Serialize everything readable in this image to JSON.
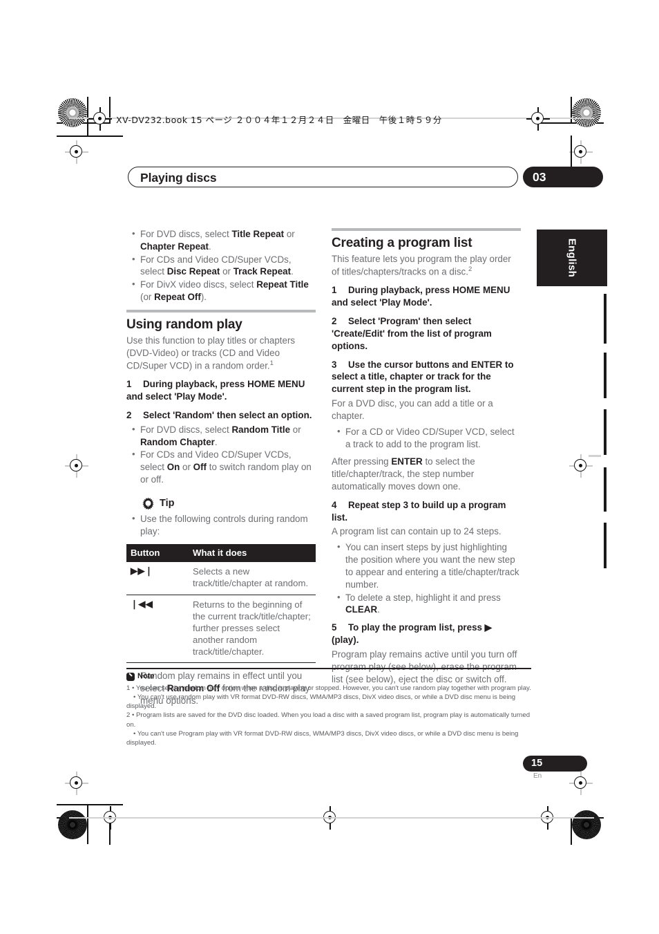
{
  "header": {
    "file_line": "XV-DV232.book  15 ページ  ２００４年１２月２４日　金曜日　午後１時５９分",
    "running_title": "Playing discs",
    "chapter_number": "03",
    "language_tab": "English"
  },
  "left_column": {
    "repeat_options": [
      {
        "parts": [
          {
            "t": "For DVD discs, select ",
            "b": false
          },
          {
            "t": "Title Repeat",
            "b": true
          },
          {
            "t": " or ",
            "b": false
          },
          {
            "t": "Chapter Repeat",
            "b": true
          },
          {
            "t": ".",
            "b": false
          }
        ]
      },
      {
        "parts": [
          {
            "t": "For CDs and Video CD/Super VCDs, select ",
            "b": false
          },
          {
            "t": "Disc Repeat",
            "b": true
          },
          {
            "t": " or ",
            "b": false
          },
          {
            "t": "Track Repeat",
            "b": true
          },
          {
            "t": ".",
            "b": false
          }
        ]
      },
      {
        "parts": [
          {
            "t": "For DivX video discs, select ",
            "b": false
          },
          {
            "t": "Repeat Title",
            "b": true
          },
          {
            "t": " (or ",
            "b": false
          },
          {
            "t": "Repeat Off",
            "b": true
          },
          {
            "t": ").",
            "b": false
          }
        ]
      }
    ],
    "section_heading": "Using random play",
    "intro": "Use this function to play titles or chapters (DVD-Video) or tracks (CD and Video CD/Super VCD) in a random order.",
    "intro_footnote": "1",
    "steps": [
      {
        "number": "1",
        "parts": [
          {
            "t": "During playback, press HOME MENU and select 'Play Mode'.",
            "b": true
          }
        ]
      },
      {
        "number": "2",
        "parts": [
          {
            "t": "Select 'Random' then select an option.",
            "b": true
          }
        ]
      }
    ],
    "random_options": [
      {
        "parts": [
          {
            "t": "For DVD discs, select ",
            "b": false
          },
          {
            "t": "Random Title",
            "b": true
          },
          {
            "t": " or ",
            "b": false
          },
          {
            "t": "Random Chapter",
            "b": true
          },
          {
            "t": ".",
            "b": false
          }
        ]
      },
      {
        "parts": [
          {
            "t": "For CDs and Video CD/Super VCDs, select ",
            "b": false
          },
          {
            "t": "On",
            "b": true
          },
          {
            "t": " or ",
            "b": false
          },
          {
            "t": "Off",
            "b": true
          },
          {
            "t": " to switch random play on or off.",
            "b": false
          }
        ]
      }
    ],
    "tip": {
      "icon": "lightbulb-icon",
      "label": "Tip",
      "items": [
        {
          "parts": [
            {
              "t": "Use the following controls during random play:",
              "b": false
            }
          ]
        }
      ]
    },
    "table": {
      "columns": [
        "Button",
        "What it does"
      ],
      "rows": [
        {
          "button_icon": "next-track-icon",
          "button_glyph": "▶▶❘",
          "description": "Selects a new track/title/chapter at random."
        },
        {
          "button_icon": "previous-track-icon",
          "button_glyph": "❘◀◀",
          "description": "Returns to the beginning of the current track/title/chapter; further presses select another random track/title/chapter."
        }
      ]
    },
    "closing_notes": [
      {
        "parts": [
          {
            "t": "Random play remains in effect until you select ",
            "b": false
          },
          {
            "t": "Random Off",
            "b": true
          },
          {
            "t": " from the random play menu options.",
            "b": false
          }
        ]
      }
    ]
  },
  "right_column": {
    "section_heading": "Creating a program list",
    "intro": "This feature lets you program the play order of titles/chapters/tracks on a disc.",
    "intro_footnote": "2",
    "step1": {
      "number": "1",
      "text": "During playback, press HOME MENU and select 'Play Mode'."
    },
    "step2": {
      "number": "2",
      "text": "Select 'Program' then select 'Create/Edit' from the list of program options."
    },
    "step3": {
      "number": "3",
      "text": "Use the cursor buttons and ENTER to select a title, chapter or track for the current step in the program list.",
      "body": "For a DVD disc, you can add a title or a chapter.",
      "bullets": [
        {
          "parts": [
            {
              "t": "For a CD or Video CD/Super VCD, select a track to add to the program list.",
              "b": false
            }
          ]
        }
      ],
      "after": [
        {
          "t": "After pressing ",
          "b": false
        },
        {
          "t": "ENTER",
          "b": true
        },
        {
          "t": " to select the title/chapter/track, the step number automatically moves down one.",
          "b": false
        }
      ]
    },
    "step4": {
      "number": "4",
      "text": "Repeat step 3 to build up a program list.",
      "body": "A program list can contain up to 24 steps.",
      "bullets": [
        {
          "parts": [
            {
              "t": "You can insert steps by just highlighting the position where you want the new step to appear and entering a title/chapter/track number.",
              "b": false
            }
          ]
        },
        {
          "parts": [
            {
              "t": "To delete a step, highlight it and press ",
              "b": false
            },
            {
              "t": "CLEAR",
              "b": true
            },
            {
              "t": ".",
              "b": false
            }
          ]
        }
      ]
    },
    "step5": {
      "number": "5",
      "text": "To play the program list, press ▶ (play).",
      "body": "Program play remains active until you turn off program play (see below), erase the program list (see below), eject the disc or switch off."
    }
  },
  "notes": {
    "icon": "note-pencil-icon",
    "label": "Note",
    "lines": [
      {
        "text": "1 • You can set the random play option when a disc is playing or stopped. However, you can't use random play together with program play.",
        "indent": false
      },
      {
        "text": "• You can't use random play with VR format DVD-RW discs, WMA/MP3 discs, DivX video discs, or while a DVD disc menu is being displayed.",
        "indent": true
      },
      {
        "text": "2 • Program lists are saved for the DVD disc loaded. When you load a disc with a saved program list, program play is automatically turned on.",
        "indent": false
      },
      {
        "text": "• You can't use Program play with VR format DVD-RW discs, WMA/MP3 discs, DivX video discs, or while a DVD disc menu is being displayed.",
        "indent": true
      }
    ]
  },
  "footer": {
    "page_number": "15",
    "language_code": "En"
  },
  "colors": {
    "ink": "#231f20",
    "body_gray": "#6d6e71",
    "rule_gray": "#b8b9bb"
  }
}
